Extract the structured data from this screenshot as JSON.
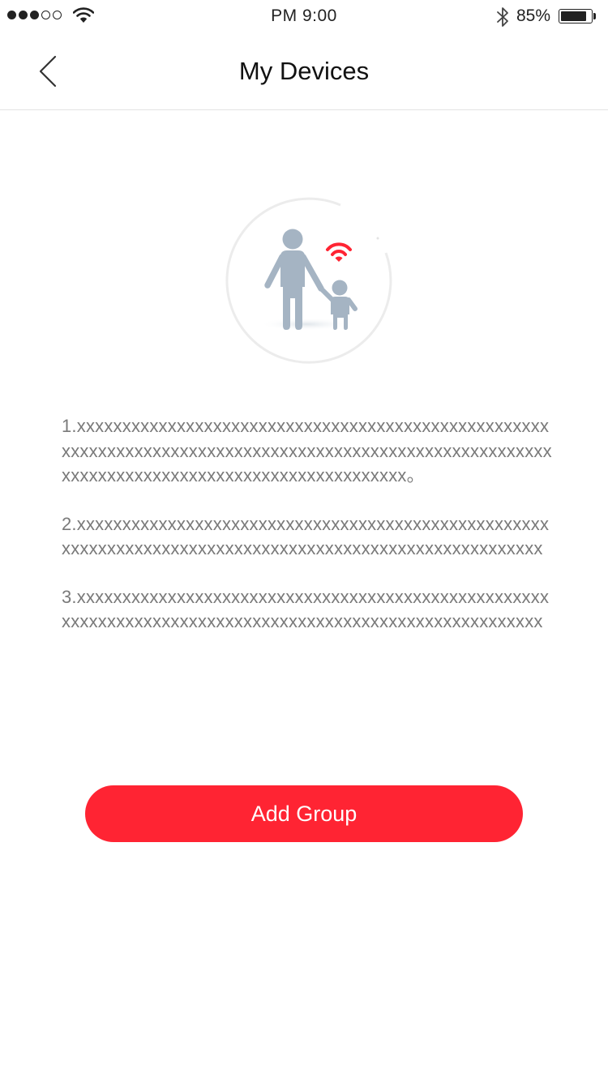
{
  "status_bar": {
    "time": "PM  9:00",
    "battery_percent": "85%",
    "signal_bars_filled": 3,
    "signal_bars_total": 5,
    "battery_level": 0.85
  },
  "nav": {
    "title": "My Devices",
    "back_icon": "chevron-left-icon"
  },
  "illustration": {
    "icon": "parent-child-wifi-icon",
    "figure_color": "#a5b4c3",
    "wifi_color": "#ff2433"
  },
  "instructions": [
    "1.xxxxxxxxxxxxxxxxxxxxxxxxxxxxxxxxxxxxxxxxxxxxxxxxxxxxxxxxxxxxxxxxxxxxxxxxxxxxxxxxxxxxxxxxxxxxxxxxxxxxxxxxxxxxxxxxxxxxxxxxxxxxxxxxxxxxxxxxxxxxxxxx。",
    "2.xxxxxxxxxxxxxxxxxxxxxxxxxxxxxxxxxxxxxxxxxxxxxxxxxxxxxxxxxxxxxxxxxxxxxxxxxxxxxxxxxxxxxxxxxxxxxxxxxxxxxxxxx",
    "3.xxxxxxxxxxxxxxxxxxxxxxxxxxxxxxxxxxxxxxxxxxxxxxxxxxxxxxxxxxxxxxxxxxxxxxxxxxxxxxxxxxxxxxxxxxxxxxxxxxxxxxxxx"
  ],
  "actions": {
    "add_group_label": "Add Group",
    "accent_color": "#ff2433"
  }
}
